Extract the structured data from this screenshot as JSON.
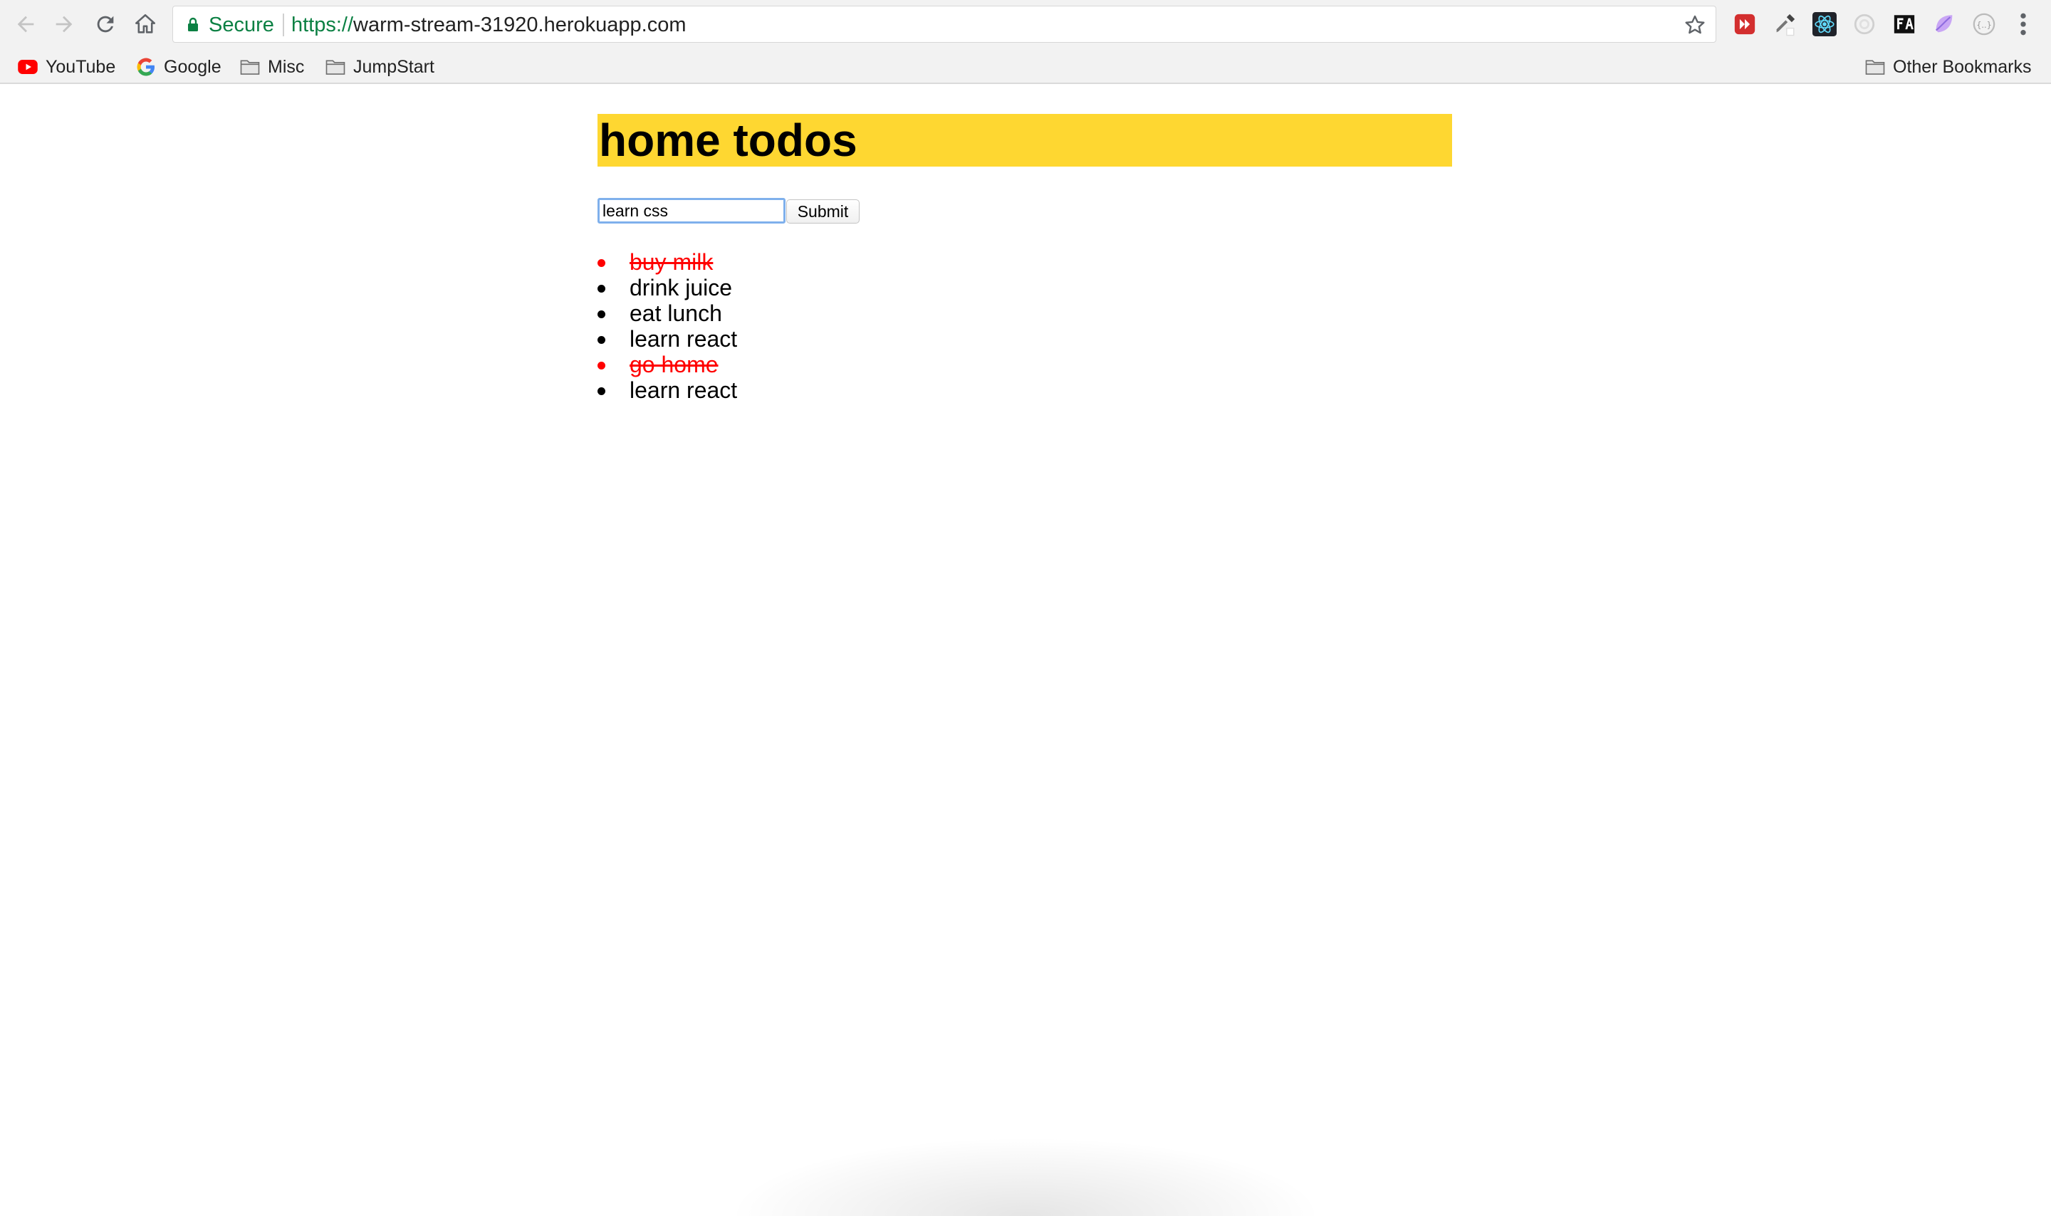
{
  "browser": {
    "security_label": "Secure",
    "url_scheme": "https://",
    "url_host": "warm-stream-31920.herokuapp.com",
    "accent_secure": "#0b8043",
    "extensions": [
      "media-extension-icon",
      "eyedropper-icon",
      "react-devtools-icon",
      "redux-devtools-icon",
      "fa-icon",
      "color-extension-icon",
      "json-extension-icon"
    ],
    "bookmarks": [
      {
        "label": "YouTube",
        "icon": "youtube-icon"
      },
      {
        "label": "Google",
        "icon": "google-icon"
      },
      {
        "label": "Misc",
        "icon": "folder-icon"
      },
      {
        "label": "JumpStart",
        "icon": "folder-icon"
      }
    ],
    "other_bookmarks": "Other Bookmarks"
  },
  "page": {
    "title": "home todos",
    "title_bg": "#fed731",
    "input": {
      "value": "learn css"
    },
    "submit_label": "Submit",
    "done_color": "#ff0000",
    "todos": [
      {
        "text": "buy milk",
        "completed": true
      },
      {
        "text": "drink juice",
        "completed": false
      },
      {
        "text": "eat lunch",
        "completed": false
      },
      {
        "text": "learn react",
        "completed": false
      },
      {
        "text": "go home",
        "completed": true
      },
      {
        "text": "learn react",
        "completed": false
      }
    ]
  }
}
